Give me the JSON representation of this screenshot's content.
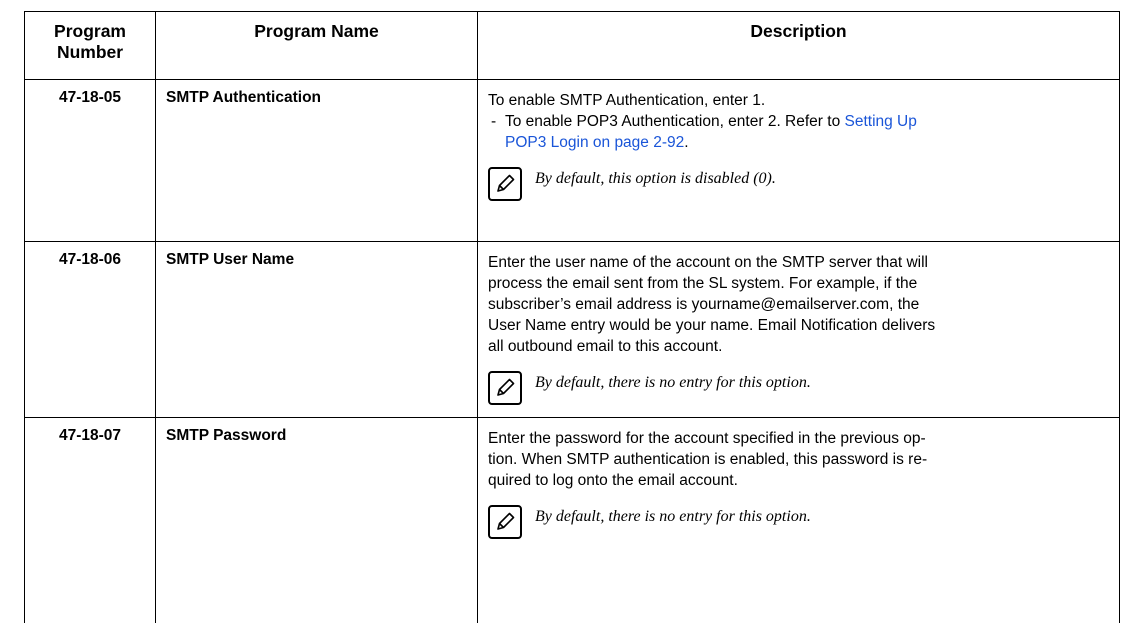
{
  "headers": {
    "program_number": "Program Number",
    "program_number_line1": "Program",
    "program_number_line2": "Number",
    "program_name": "Program Name",
    "description": "Description"
  },
  "rows": [
    {
      "number": "47-18-05",
      "name": "SMTP Authentication",
      "desc_line1": "To enable SMTP Authentication, enter 1.",
      "bullet_dash": "-",
      "bullet_text": "To enable POP3 Authentication, enter 2. Refer to ",
      "link_text_1": "Setting Up",
      "link_text_2": "POP3 Login on page 2-92",
      "bullet_end": ".",
      "note_icon": "pencil-icon",
      "note": "By default, this option is disabled (0)."
    },
    {
      "number": "47-18-06",
      "name": "SMTP User Name",
      "desc_lines": [
        "Enter the user name of the account on the SMTP server that will",
        "process the email sent from the SL system. For example, if the",
        "subscriber’s email address is yourname@emailserver.com, the",
        "User Name entry would be your name. Email Notification delivers",
        "all outbound email to this account."
      ],
      "note_icon": "pencil-icon",
      "note": "By default, there is no entry for this option."
    },
    {
      "number": "47-18-07",
      "name": "SMTP Password",
      "desc_lines": [
        "Enter the password for the account specified in the previous op-",
        "tion. When SMTP authentication is enabled, this password is re-",
        "quired to log onto the email account."
      ],
      "note_icon": "pencil-icon",
      "note": "By default, there is no entry for this option."
    }
  ],
  "colors": {
    "link": "#1a55d8",
    "border": "#000000"
  }
}
